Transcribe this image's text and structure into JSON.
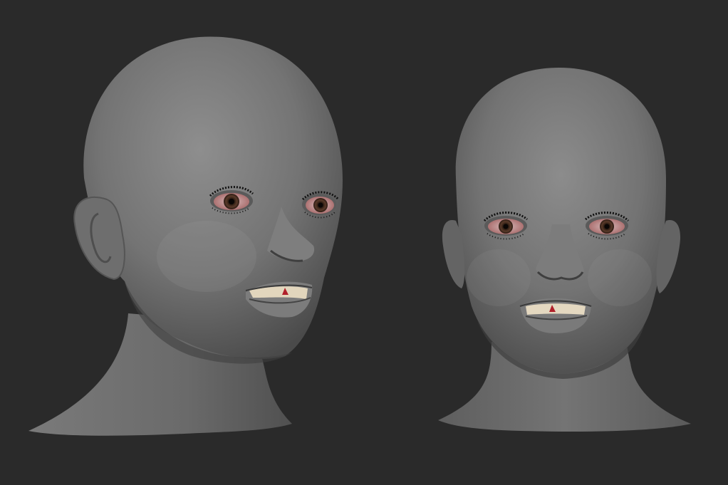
{
  "scene": {
    "background_color": "#2a2a2a",
    "skin_color": "#7a7a7a",
    "iris_color": "#5a3a2a",
    "sclera_tint": "#c9a2a2",
    "teeth_color": "#e8dcc4",
    "lash_color": "#111111",
    "models": [
      {
        "name": "head-three-quarter-view",
        "view": "three-quarter"
      },
      {
        "name": "head-front-view",
        "view": "front"
      }
    ]
  }
}
